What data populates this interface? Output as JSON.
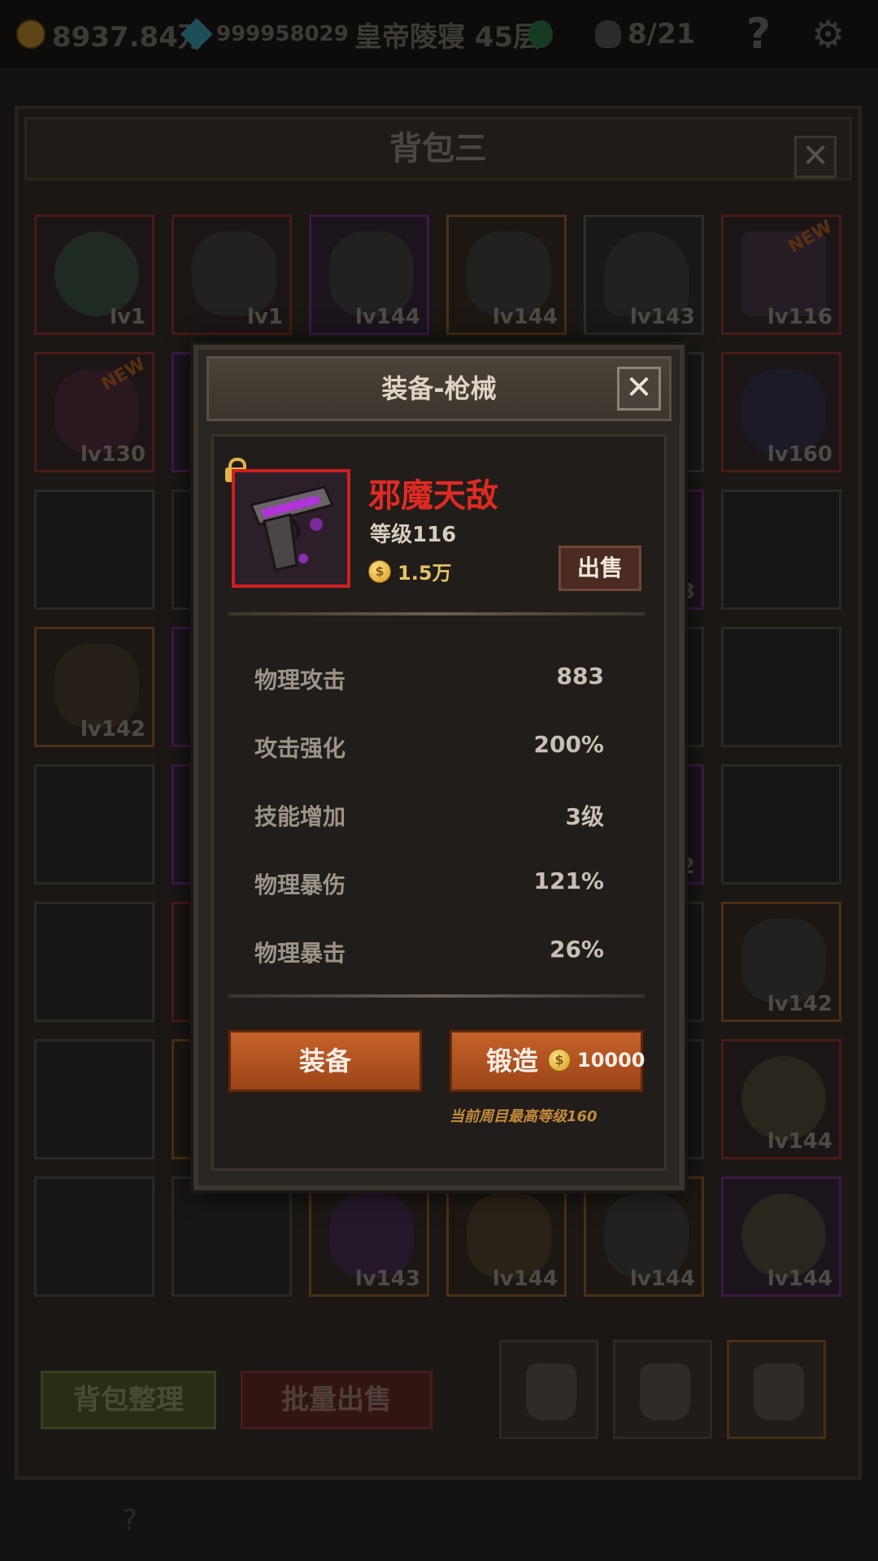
{
  "topbar": {
    "gold": "8937.84万",
    "gems": "999958029",
    "stage": "皇帝陵寝 45层",
    "kills": "8/21",
    "help_glyph": "?",
    "gear_glyph": "⚙"
  },
  "bag": {
    "title": "背包三",
    "close_glyph": "✕",
    "sort_label": "背包整理",
    "bulk_sell_label": "批量出售",
    "new_tag": "NEW",
    "visible_levels": {
      "r1": [
        "lv1",
        "lv1",
        "lv144",
        "lv144",
        "lv143",
        "lv116"
      ],
      "r2_first": "lv130",
      "r2_last": "lv160",
      "r3_partial": "3",
      "r4_first": "lv142",
      "r5_partial": "2",
      "r6_last": "lv142",
      "r7_last": "lv144",
      "r8": [
        "lv143",
        "lv144",
        "lv144",
        "lv144"
      ]
    },
    "bottom_hint": "?"
  },
  "modal": {
    "title": "装备-枪械",
    "close_glyph": "✕",
    "item": {
      "name": "邪魔天敌",
      "level": "等级116",
      "price": "1.5万",
      "coin_glyph": "$",
      "sell_label": "出售"
    },
    "stats": [
      {
        "label": "物理攻击",
        "value": "883"
      },
      {
        "label": "攻击强化",
        "value": "200%"
      },
      {
        "label": "技能增加",
        "value": "3级"
      },
      {
        "label": "物理暴伤",
        "value": "121%"
      },
      {
        "label": "物理暴击",
        "value": "26%"
      }
    ],
    "equip_label": "装备",
    "forge_label": "锻造",
    "forge_cost": "10000",
    "max_level_note": "当前周目最高等级160"
  },
  "colors": {
    "item_name": "#e22a22",
    "item_frame": "#d01f1f",
    "action_button": "#c5622a",
    "gold_text": "#e5c267"
  }
}
